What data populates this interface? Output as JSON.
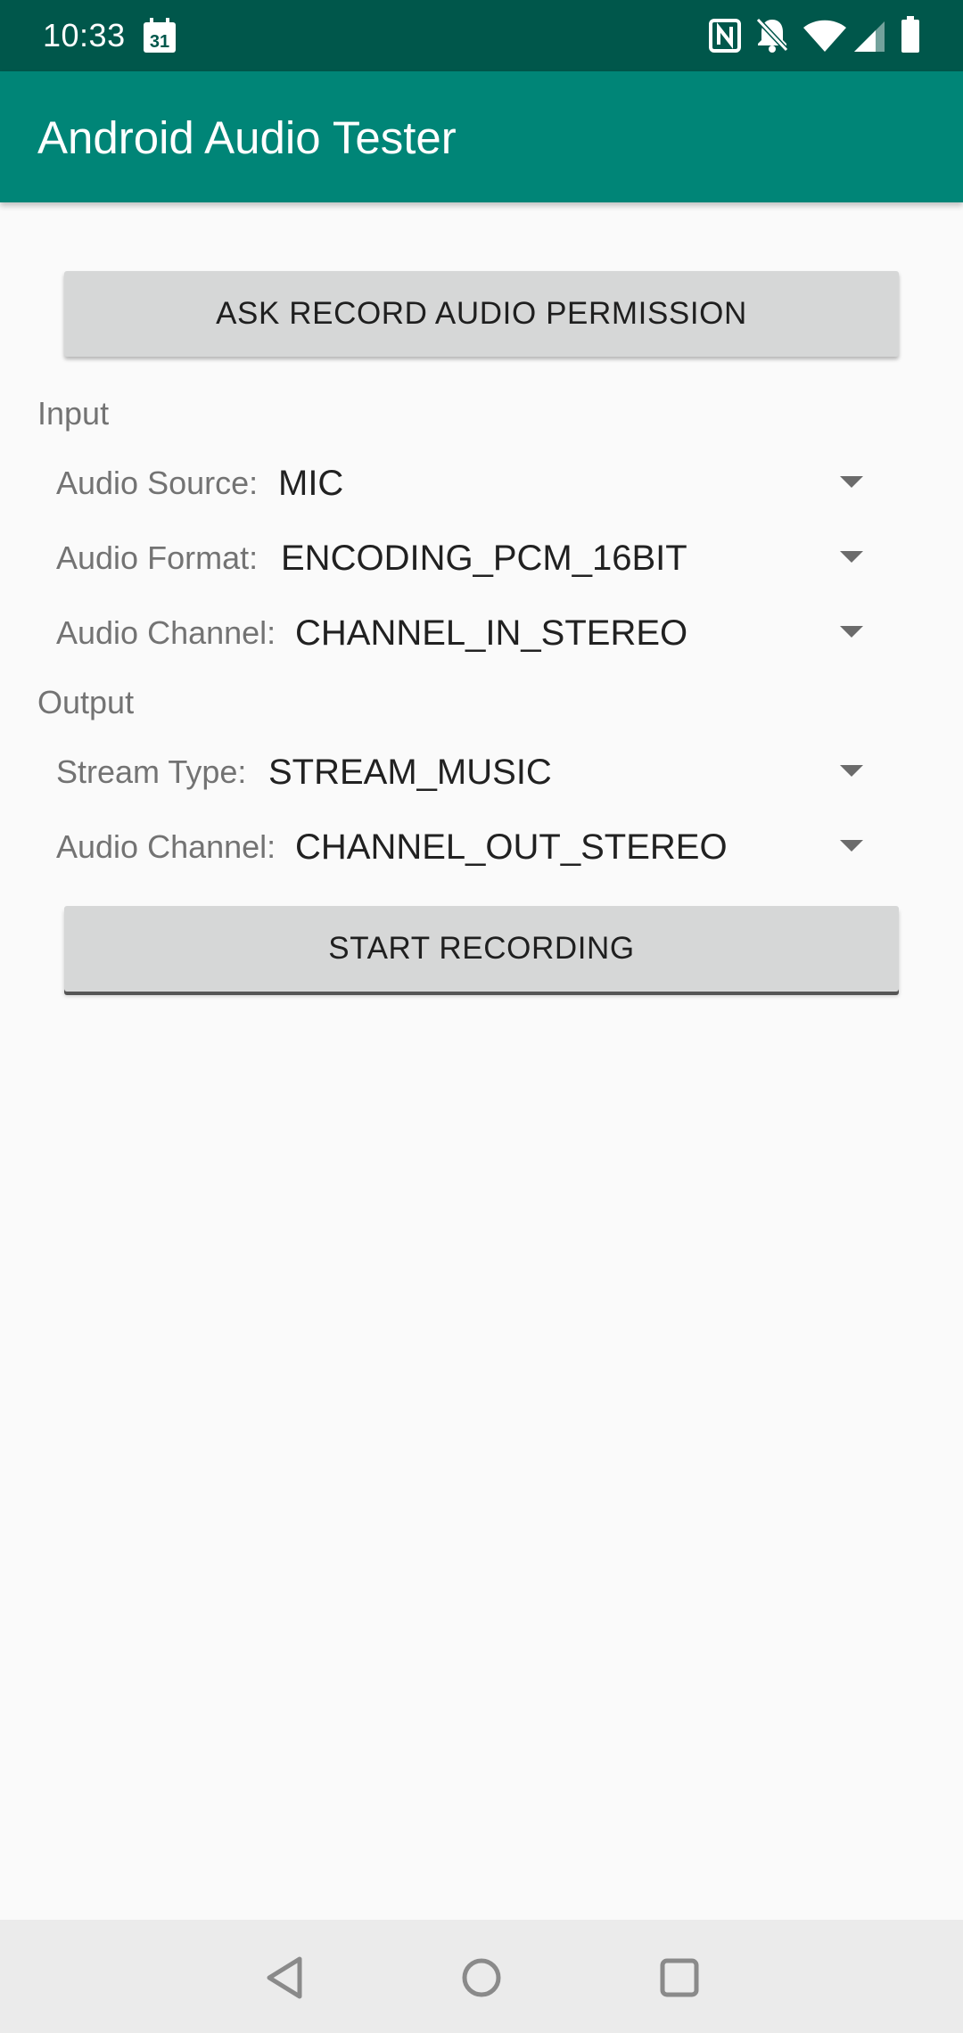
{
  "status_bar": {
    "time": "10:33",
    "calendar_day": "31",
    "icons": [
      "calendar-icon",
      "nfc-icon",
      "notifications-off-icon",
      "wifi-icon",
      "signal-icon",
      "battery-icon"
    ]
  },
  "app_bar": {
    "title": "Android Audio Tester"
  },
  "permission_button": {
    "label": "ASK RECORD AUDIO PERMISSION"
  },
  "input": {
    "section_label": "Input",
    "audio_source": {
      "label": "Audio Source:",
      "value": "MIC"
    },
    "audio_format": {
      "label": "Audio Format:",
      "value": "ENCODING_PCM_16BIT"
    },
    "audio_channel": {
      "label": "Audio Channel:",
      "value": "CHANNEL_IN_STEREO"
    }
  },
  "output": {
    "section_label": "Output",
    "stream_type": {
      "label": "Stream Type:",
      "value": "STREAM_MUSIC"
    },
    "audio_channel": {
      "label": "Audio Channel:",
      "value": "CHANNEL_OUT_STEREO"
    }
  },
  "start_button": {
    "label": "START RECORDING"
  },
  "nav_bar": {
    "buttons": [
      "back-icon",
      "home-icon",
      "recents-icon"
    ]
  },
  "colors": {
    "status_bar": "#00574b",
    "app_bar": "#008577",
    "background": "#fafafa",
    "button": "#d6d7d7",
    "nav_bar": "#ebebeb"
  }
}
